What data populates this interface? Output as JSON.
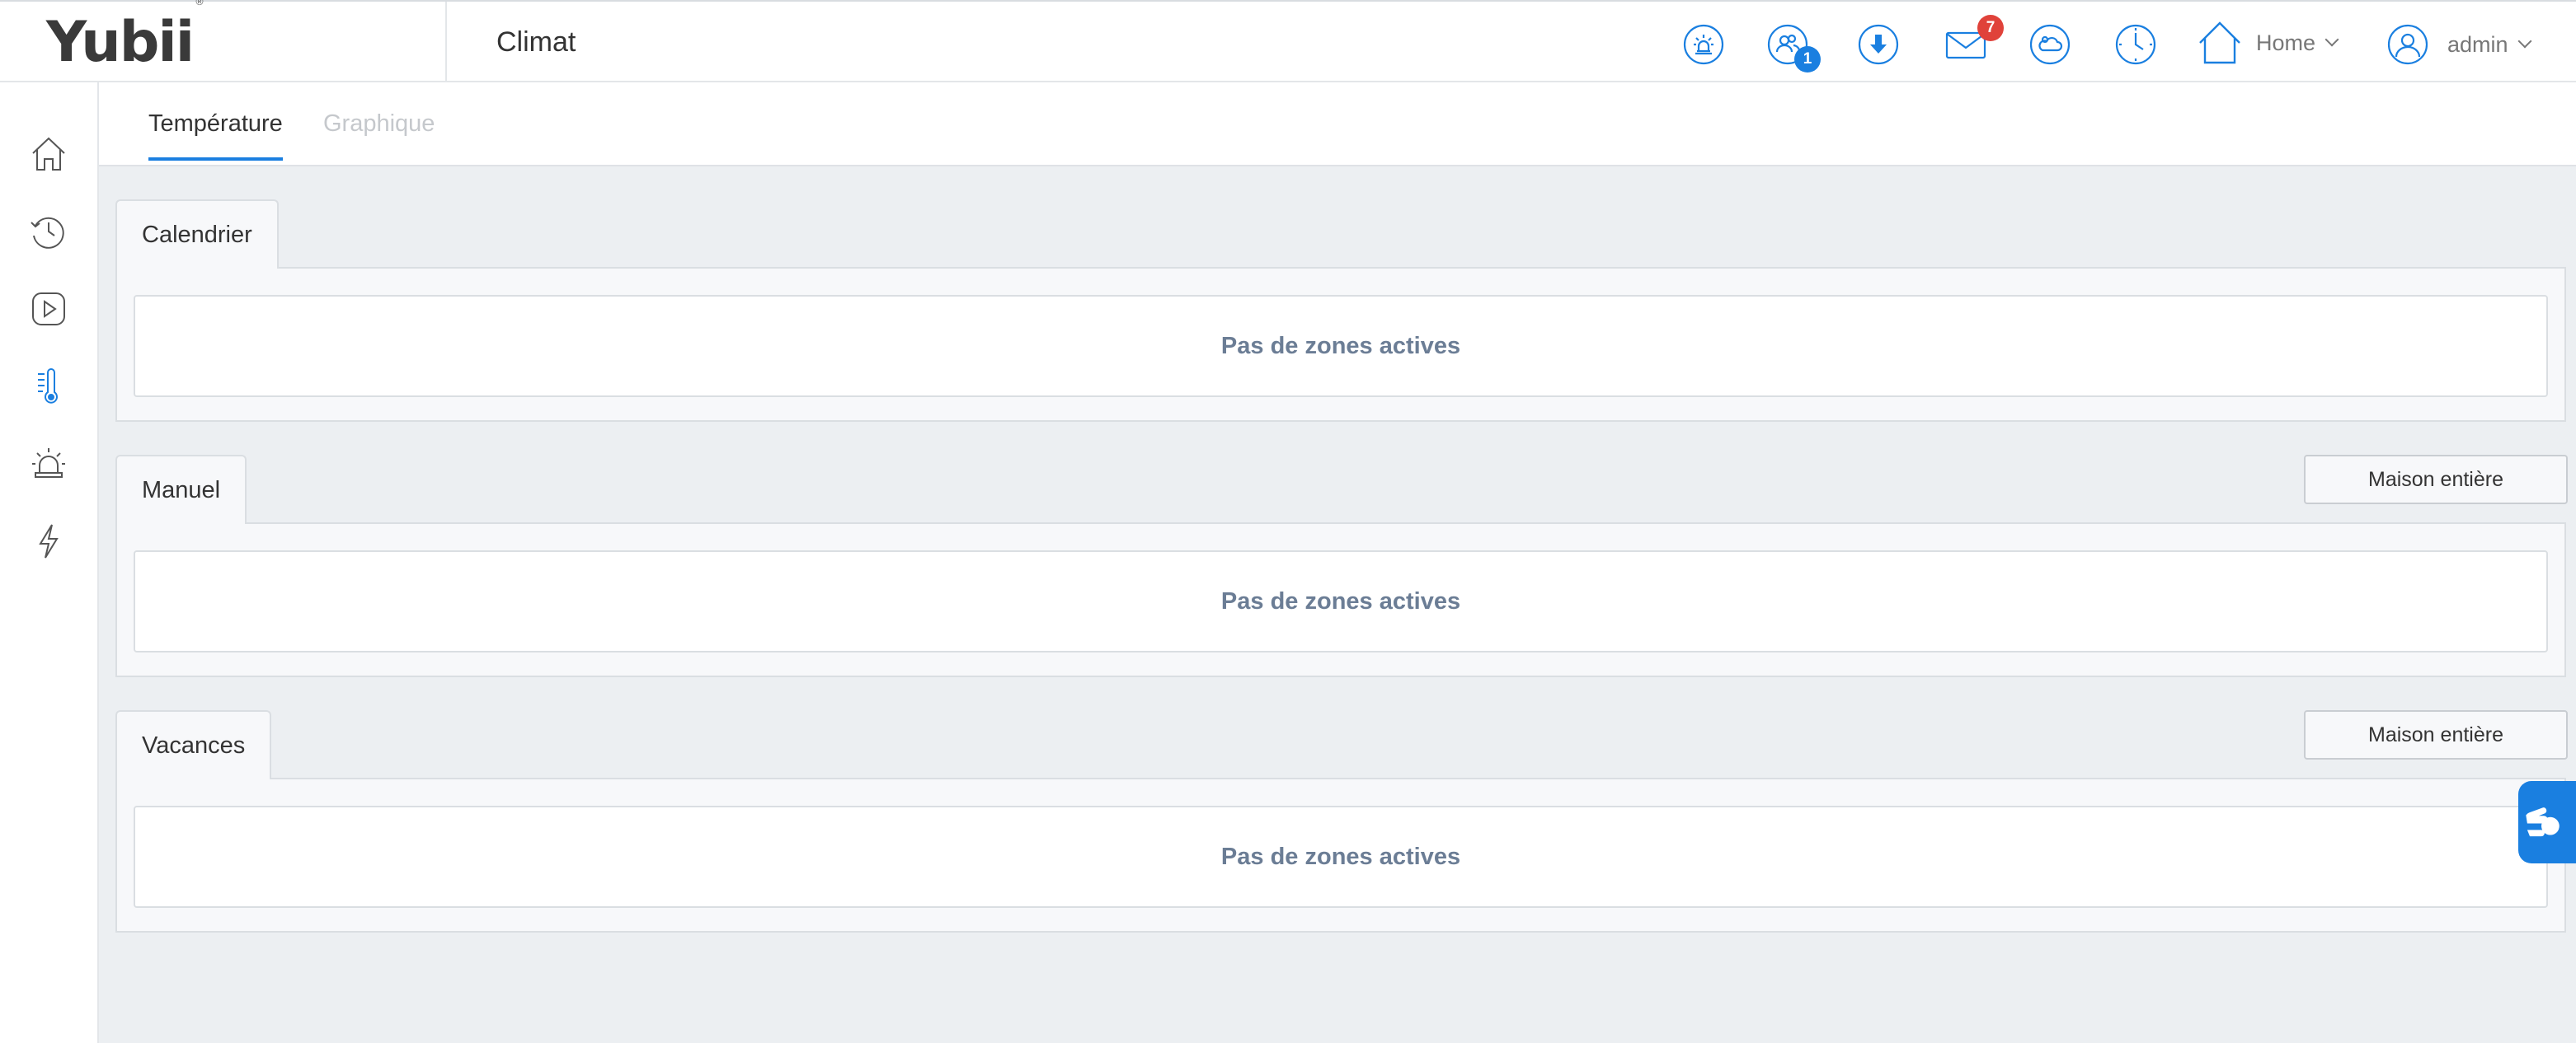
{
  "brand": {
    "logo": "Yubii",
    "trademark": "®"
  },
  "page": {
    "title": "Climat"
  },
  "header": {
    "icons": [
      "alarm-icon",
      "users-icon",
      "download-icon",
      "mail-icon",
      "weather-icon",
      "clock-icon",
      "home-icon",
      "user-icon"
    ],
    "users_badge": "1",
    "mail_badge": "7",
    "home_label": "Home",
    "user_label": "admin"
  },
  "sidebar": {
    "items": [
      "home-icon",
      "scenes-clock-icon",
      "play-icon",
      "thermometer-icon",
      "alarm-icon",
      "energy-icon"
    ],
    "active_item": "thermometer-icon"
  },
  "tabs": [
    {
      "label": "Température",
      "active": true
    },
    {
      "label": "Graphique",
      "active": false
    }
  ],
  "sections": [
    {
      "title": "Calendrier",
      "empty_text": "Pas de zones actives"
    },
    {
      "title": "Manuel",
      "empty_text": "Pas de zones actives",
      "button": "Maison entière"
    },
    {
      "title": "Vacances",
      "empty_text": "Pas de zones actives",
      "button": "Maison entière"
    }
  ],
  "colors": {
    "accent": "#1a7fe0",
    "badge_red": "#e0423a",
    "muted_text": "#6b7d95"
  }
}
